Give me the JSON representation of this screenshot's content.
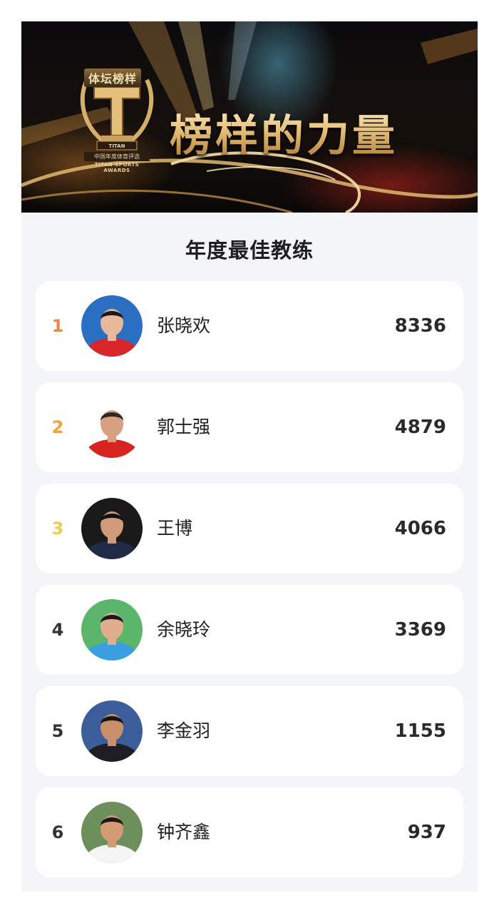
{
  "banner": {
    "logo_top": "体坛榜样",
    "logo_brand": "TITAN",
    "logo_cn": "中国年度体育评选",
    "logo_en": "TITAN SPORTS AWARDS",
    "title": "榜样的力量"
  },
  "section_title": "年度最佳教练",
  "rank_colors": {
    "1": "#e8874a",
    "2": "#f0a23c",
    "3": "#f3c95a",
    "default": "#333333"
  },
  "coaches": [
    {
      "rank": "1",
      "name": "张晓欢",
      "votes": "8336",
      "avatar": "coach-zhang-xiaohuan-photo"
    },
    {
      "rank": "2",
      "name": "郭士强",
      "votes": "4879",
      "avatar": "coach-guo-shiqiang-photo"
    },
    {
      "rank": "3",
      "name": "王博",
      "votes": "4066",
      "avatar": "coach-wang-bo-photo"
    },
    {
      "rank": "4",
      "name": "余晓玲",
      "votes": "3369",
      "avatar": "coach-yu-xiaoling-photo"
    },
    {
      "rank": "5",
      "name": "李金羽",
      "votes": "1155",
      "avatar": "coach-li-jinyu-photo"
    },
    {
      "rank": "6",
      "name": "钟齐鑫",
      "votes": "937",
      "avatar": "coach-zhong-qixin-photo"
    }
  ]
}
